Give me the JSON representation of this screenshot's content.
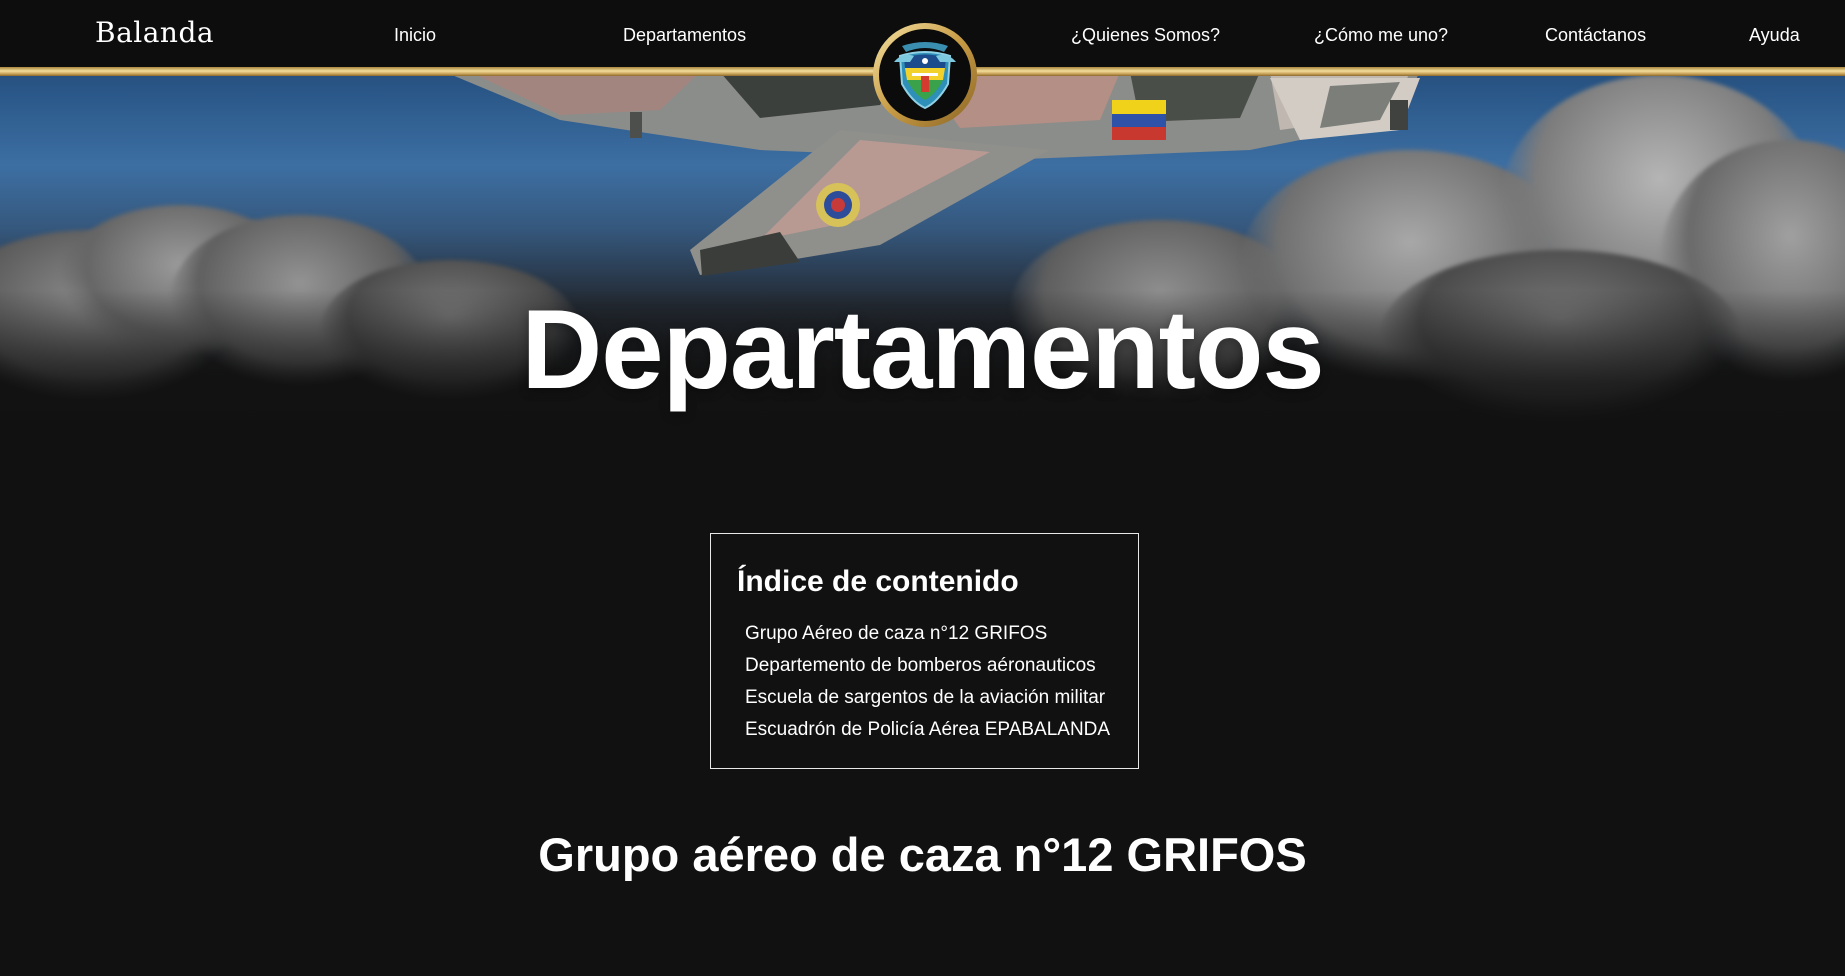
{
  "nav": {
    "brand": "Balanda",
    "items": [
      {
        "label": "Inicio"
      },
      {
        "label": "Departamentos"
      },
      {
        "label": "¿Quienes Somos?"
      },
      {
        "label": "¿Cómo me uno?"
      },
      {
        "label": "Contáctanos"
      },
      {
        "label": "Ayuda"
      }
    ]
  },
  "hero": {
    "title": "Departamentos"
  },
  "toc": {
    "title": "Índice de contenido",
    "items": [
      {
        "label": "Grupo Aéreo de caza n°12 GRIFOS"
      },
      {
        "label": "Departemento de bomberos aéronauticos"
      },
      {
        "label": "Escuela de sargentos de la aviación militar"
      },
      {
        "label": "Escuadrón de Policía Aérea EPABALANDA"
      }
    ]
  },
  "section": {
    "title": "Grupo aéreo de caza n°12 GRIFOS"
  },
  "colors": {
    "background": "#111111",
    "navbar": "#0d0d0d",
    "gold": "#d8b86a",
    "sky": "#3d6fa3",
    "text": "#ffffff"
  },
  "icons": {
    "emblem": "air-force-crest-icon"
  }
}
